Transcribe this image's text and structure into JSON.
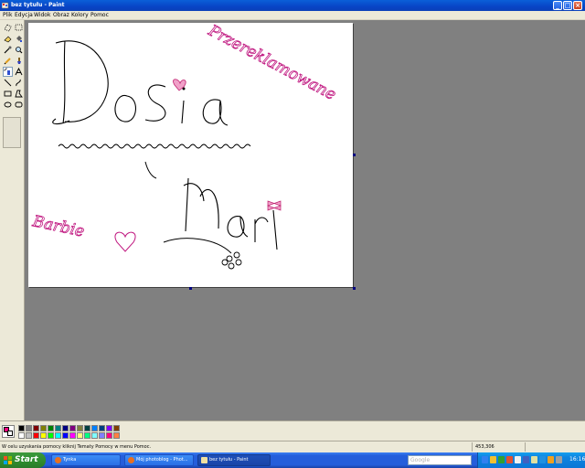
{
  "window": {
    "title": "bez tytułu - Paint"
  },
  "menu": [
    "Plik",
    "Edycja",
    "Widok",
    "Obraz",
    "Kolory",
    "Pomoc"
  ],
  "tools": [
    "free-select",
    "select",
    "eraser",
    "fill",
    "color-picker",
    "magnifier",
    "pencil",
    "brush",
    "airbrush",
    "text",
    "line",
    "curve",
    "rectangle",
    "polygon",
    "ellipse",
    "rounded-rectangle"
  ],
  "selected_tool": "airbrush",
  "canvas": {
    "texts": [
      "Dosia",
      "i",
      "Mari",
      "Przereklamowane",
      "Barbie"
    ]
  },
  "palette": {
    "foreground": "#ff0080",
    "background": "#ffffff",
    "colors": [
      "#000000",
      "#808080",
      "#800000",
      "#808000",
      "#008000",
      "#008080",
      "#000080",
      "#800080",
      "#808040",
      "#004040",
      "#0080ff",
      "#004080",
      "#8000ff",
      "#804000",
      "#ffffff",
      "#c0c0c0",
      "#ff0000",
      "#ffff00",
      "#00ff00",
      "#00ffff",
      "#0000ff",
      "#ff00ff",
      "#ffff80",
      "#00ff80",
      "#80ffff",
      "#8080ff",
      "#ff0080",
      "#ff8040"
    ]
  },
  "status": {
    "help": "W celu uzyskania pomocy kliknij Tematy Pomocy w menu Pomoc.",
    "coords": "453,306"
  },
  "taskbar": {
    "start": "Start",
    "tasks": [
      "Tynka",
      "Mój photoblog - Phot...",
      "bez tytułu - Paint"
    ],
    "search_placeholder": "Google",
    "clock": "16:16"
  }
}
